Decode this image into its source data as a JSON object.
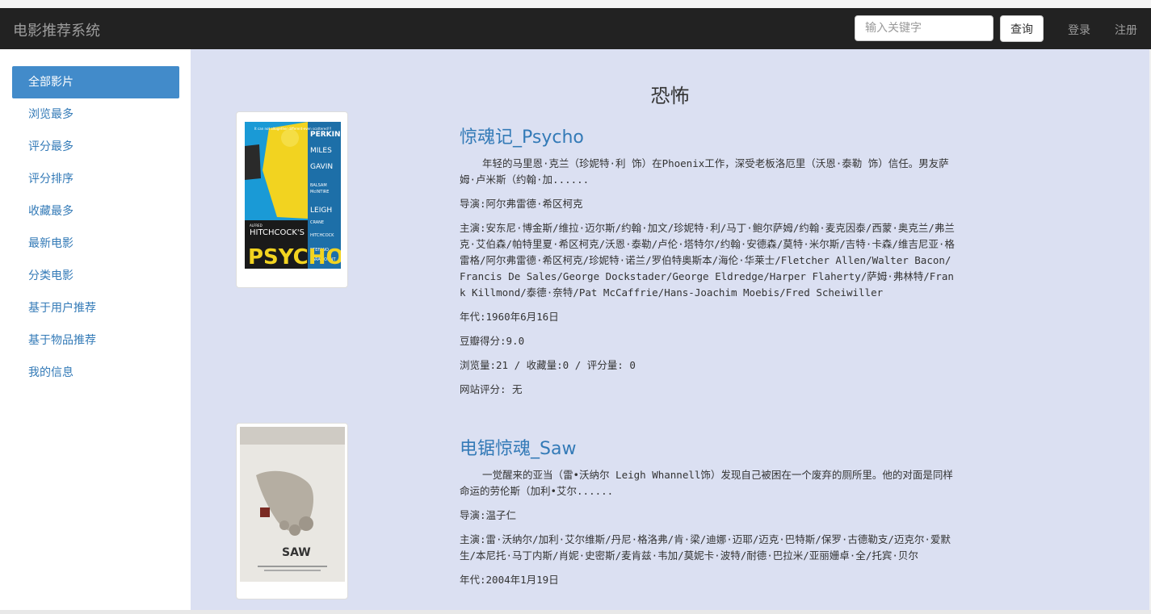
{
  "header": {
    "brand": "电影推荐系统",
    "search_placeholder": "输入关键字",
    "search_button": "查询",
    "login": "登录",
    "register": "注册"
  },
  "sidebar": {
    "items": [
      {
        "label": "全部影片",
        "active": true
      },
      {
        "label": "浏览最多",
        "active": false
      },
      {
        "label": "评分最多",
        "active": false
      },
      {
        "label": "评分排序",
        "active": false
      },
      {
        "label": "收藏最多",
        "active": false
      },
      {
        "label": "最新电影",
        "active": false
      },
      {
        "label": "分类电影",
        "active": false
      },
      {
        "label": "基于用户推荐",
        "active": false
      },
      {
        "label": "基于物品推荐",
        "active": false
      },
      {
        "label": "我的信息",
        "active": false
      }
    ]
  },
  "main": {
    "category_title": "恐怖",
    "movies": [
      {
        "title": "惊魂记_Psycho",
        "description": "年轻的马里恩·克兰（珍妮特·利 饰）在Phoenix工作，深受老板洛厄里（沃恩·泰勒 饰）信任。男友萨姆·卢米斯（约翰·加......",
        "director": "导演:阿尔弗雷德·希区柯克",
        "cast": "主演:安东尼·博金斯/维拉·迈尔斯/约翰·加文/珍妮特·利/马丁·鲍尔萨姆/约翰·麦克因泰/西蒙·奥克兰/弗兰克·艾伯森/帕特里夏·希区柯克/沃恩·泰勒/卢伦·塔特尔/约翰·安德森/莫特·米尔斯/吉特·卡森/维吉尼亚·格雷格/阿尔弗雷德·希区柯克/珍妮特·诺兰/罗伯特奥斯本/海伦·华莱士/Fletcher Allen/Walter Bacon/Francis De Sales/George Dockstader/George Eldredge/Harper Flaherty/萨姆·弗林特/Frank Killmond/泰德·奈特/Pat McCaffrie/Hans-Joachim Moebis/Fred Scheiwiller",
        "year": "年代:1960年6月16日",
        "douban": "豆瓣得分:9.0",
        "stats": "浏览量:21 / 收藏量:0 / 评分量: 0",
        "site_rating": "网站评分: 无",
        "poster": {
          "top_text": "It can not altogether different-even scattered!!!",
          "credits": [
            "PERKINS",
            "MILES",
            "GAVIN",
            "BALSAM",
            "McINTIRE",
            "LEIGH",
            "CRANE",
            "HITCHCOCK",
            "STEFANO",
            "PARAMOUNT"
          ],
          "studio": "ALFRED",
          "byline": "HITCHCOCK'S",
          "logo": "PSYCHO"
        }
      },
      {
        "title": "电锯惊魂_Saw",
        "description": "一觉醒来的亚当（雷•沃纳尔 Leigh Whannell饰）发现自己被困在一个废弃的厕所里。他的对面是同样命运的劳伦斯（加利•艾尔......",
        "director": "导演:温子仁",
        "cast": "主演:雷·沃纳尔/加利·艾尔维斯/丹尼·格洛弗/肯·梁/迪娜·迈耶/迈克·巴特斯/保罗·古德勒支/迈克尔·爱默生/本尼托·马丁内斯/肖妮·史密斯/麦肯兹·韦加/莫妮卡·波特/耐德·巴拉米/亚丽姗卓·全/托宾·贝尔",
        "year": "年代:2004年1月19日",
        "poster": {
          "logo": "SAW"
        }
      }
    ]
  },
  "colors": {
    "navbar_bg": "#222222",
    "active_item_bg": "#428bca",
    "link": "#337ab7",
    "main_bg": "#dbe0f2"
  }
}
